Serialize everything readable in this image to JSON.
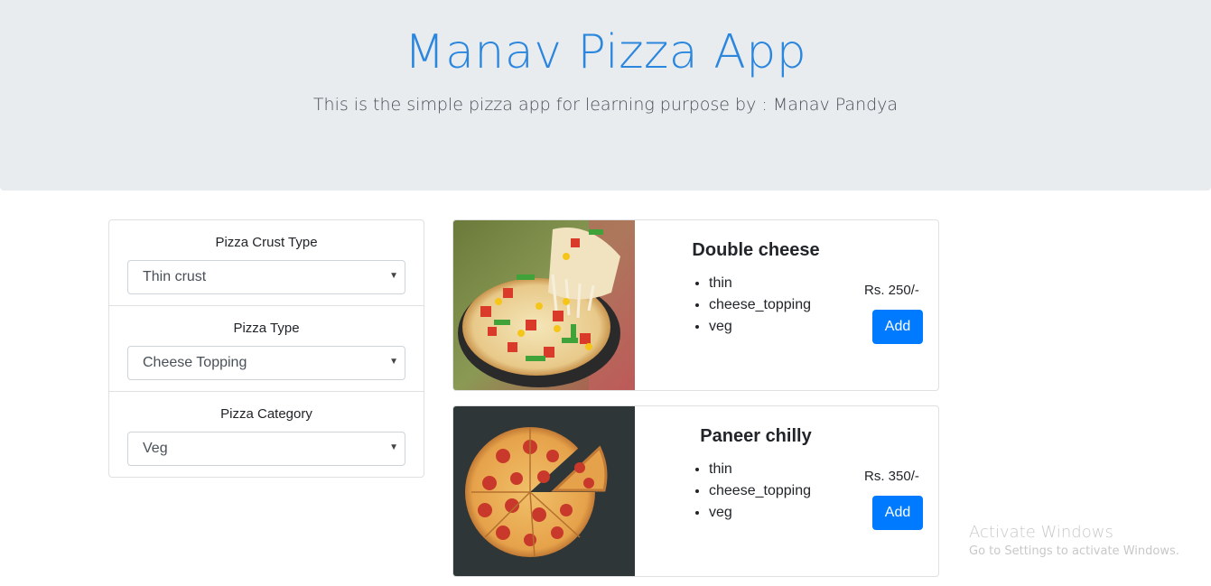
{
  "header": {
    "title": "Manav Pizza App",
    "subtitle": "This is the simple pizza app for learning purpose by : Manav Pandya"
  },
  "filters": [
    {
      "label": "Pizza Crust Type",
      "selected": "Thin crust"
    },
    {
      "label": "Pizza Type",
      "selected": "Cheese Topping"
    },
    {
      "label": "Pizza Category",
      "selected": "Veg"
    }
  ],
  "products": [
    {
      "name": "Double cheese",
      "image": "cheese-pizza-pan-photo",
      "attributes": [
        "thin",
        "cheese_topping",
        "veg"
      ],
      "price": "Rs. 250/-",
      "button_label": "Add"
    },
    {
      "name": "Paneer chilly",
      "image": "pepperoni-pizza-photo",
      "attributes": [
        "thin",
        "cheese_topping",
        "veg"
      ],
      "price": "Rs. 350/-",
      "button_label": "Add"
    }
  ],
  "icons": {
    "select_caret": "▼"
  },
  "colors": {
    "accent": "#007bff",
    "title": "#2b86de",
    "jumbotron_bg": "#e9ecef"
  },
  "watermark": {
    "line1": "Activate Windows",
    "line2": "Go to Settings to activate Windows."
  }
}
